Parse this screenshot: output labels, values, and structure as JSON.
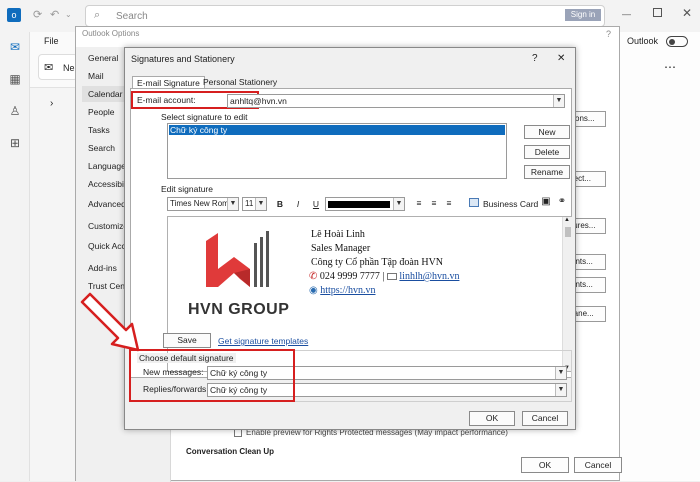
{
  "outlook": {
    "search_placeholder": "Search",
    "sign_in": "Sign in",
    "file_tab": "File",
    "new_label": "Ne",
    "outlook_toggle_label": "Outlook",
    "toggle_state": "Off"
  },
  "options": {
    "title": "Outlook Options",
    "nav": [
      "General",
      "Mail",
      "Calendar",
      "People",
      "Tasks",
      "Search",
      "Language",
      "Accessibili",
      "Advanced",
      "Customize",
      "Quick Acc",
      "Add-ins",
      "Trust Cente"
    ],
    "right_buttons": [
      "tions...",
      "rect...",
      "tures...",
      "onts...",
      "onts...",
      "rane..."
    ],
    "bottom_text": "Conversation Clean Up",
    "partial_text": "Enable preview for Rights Protected messages (May impact performance)",
    "ok": "OK",
    "cancel": "Cancel"
  },
  "sig_dialog": {
    "title": "Signatures and Stationery",
    "help": "?",
    "close": "✕",
    "tabs": [
      "E-mail Signature",
      "Personal Stationery"
    ],
    "email_account_label": "E-mail account:",
    "email_account_value": "anhltq@hvn.vn",
    "select_label": "Select signature to edit",
    "signatures": [
      "Chữ ký công ty"
    ],
    "new": "New",
    "delete": "Delete",
    "rename": "Rename",
    "edit_label": "Edit signature",
    "font_name": "Times New Roman",
    "font_size": "11",
    "bold": "B",
    "italic": "I",
    "underline": "U",
    "business_card": "Business Card",
    "logo_text": "HVN GROUP",
    "sig_name": "Lê Hoài Linh",
    "sig_title": "Sales Manager",
    "sig_company": "Công ty Cổ phần Tập đoàn HVN",
    "sig_phone": "024 9999 7777",
    "sig_email": "linhlh@hvn.vn",
    "sig_web": "https://hvn.vn",
    "save": "Save",
    "templates_link": "Get signature templates",
    "default_label": "Choose default signature",
    "new_messages_label": "New messages:",
    "new_messages_value": "Chữ ký công ty",
    "replies_label": "Replies/forwards:",
    "replies_value": "Chữ ký công ty",
    "ok": "OK",
    "cancel": "Cancel"
  },
  "colors": {
    "accent": "#0f6cbd",
    "highlight": "#d61f1f",
    "logo_red": "#e03a3a",
    "logo_gray": "#555555"
  }
}
